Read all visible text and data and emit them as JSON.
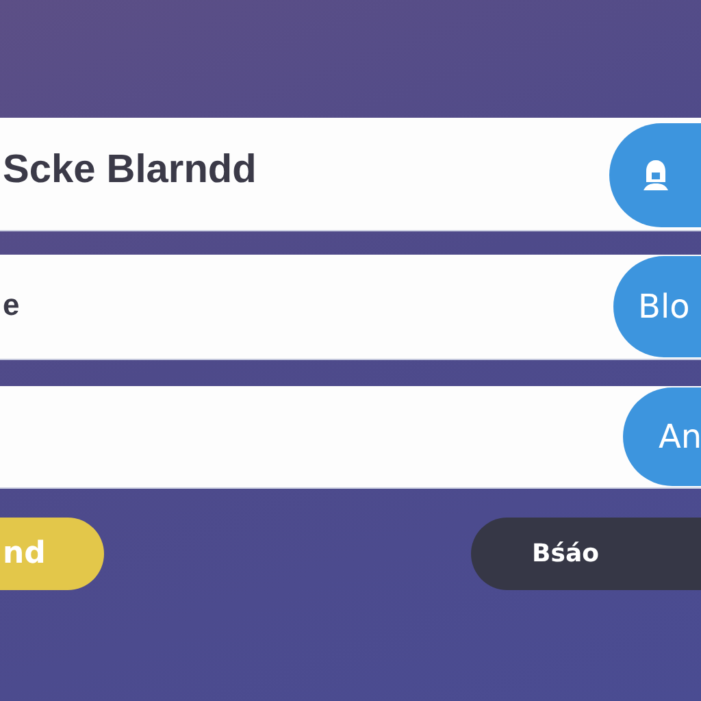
{
  "rows": [
    {
      "value": "Scke Blarndd",
      "button": {
        "kind": "icon"
      }
    },
    {
      "value": "e",
      "button": {
        "kind": "text",
        "label": "Blo"
      }
    },
    {
      "button": {
        "kind": "text",
        "label": "An"
      }
    }
  ],
  "actions": [
    {
      "kind": "primary",
      "label": "nd"
    },
    {
      "kind": "secondary",
      "label": "Bśáo"
    }
  ]
}
